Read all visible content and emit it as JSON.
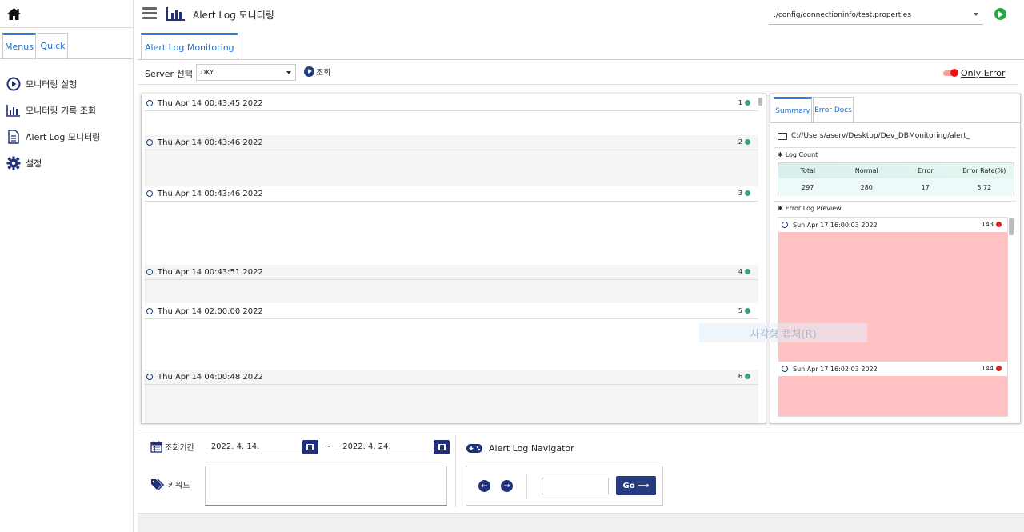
{
  "sidebar": {
    "tabs": [
      {
        "label": "Menus"
      },
      {
        "label": "Quick"
      }
    ],
    "items": [
      {
        "label": "모니터링 실행"
      },
      {
        "label": "모니터링 기록 조회"
      },
      {
        "label": "Alert Log 모니터링"
      },
      {
        "label": "설정"
      }
    ]
  },
  "header": {
    "title": "Alert Log 모니터링",
    "config_path": "./config/connectioninfo/test.properties"
  },
  "main_tab": {
    "label": "Alert Log Monitoring"
  },
  "filter": {
    "server_label": "Server 선택",
    "server_value": "DKY",
    "query_label": "조회",
    "only_error_label": "Only Error"
  },
  "logs": [
    {
      "time": "Thu Apr 14 00:43:45 2022",
      "num": "1"
    },
    {
      "time": "Thu Apr 14 00:43:46 2022",
      "num": "2"
    },
    {
      "time": "Thu Apr 14 00:43:46 2022",
      "num": "3"
    },
    {
      "time": "Thu Apr 14 00:43:51 2022",
      "num": "4"
    },
    {
      "time": "Thu Apr 14 02:00:00 2022",
      "num": "5"
    },
    {
      "time": "Thu Apr 14 04:00:48 2022",
      "num": "6"
    }
  ],
  "right_panel": {
    "tabs": [
      {
        "label": "Summary"
      },
      {
        "label": "Error Docs"
      }
    ],
    "path": "C://Users/aserv/Desktop/Dev_DBMonitoring/alert_",
    "log_count_label": "Log Count",
    "count_headers": [
      "Total",
      "Normal",
      "Error",
      "Error Rate(%)"
    ],
    "count_values": [
      "297",
      "280",
      "17",
      "5.72"
    ],
    "error_preview_label": "Error Log Preview",
    "errors": [
      {
        "time": "Sun Apr 17 16:00:03 2022",
        "num": "143"
      },
      {
        "time": "Sun Apr 17 16:02:03 2022",
        "num": "144"
      }
    ]
  },
  "watermark": "사각형 캡처(R)",
  "bottom": {
    "period_label": "조회기간",
    "start_date": "2022. 4. 14.",
    "tilde": "~",
    "end_date": "2022. 4. 24.",
    "keyword_label": "키워드",
    "navigator_title": "Alert Log Navigator",
    "go_label": "Go ⟶"
  },
  "colors": {
    "accent": "#2f7fd8",
    "navy": "#1f2f7a",
    "ok": "#3aa37a",
    "error": "#e02525",
    "error_bg": "#ffc1c1"
  }
}
